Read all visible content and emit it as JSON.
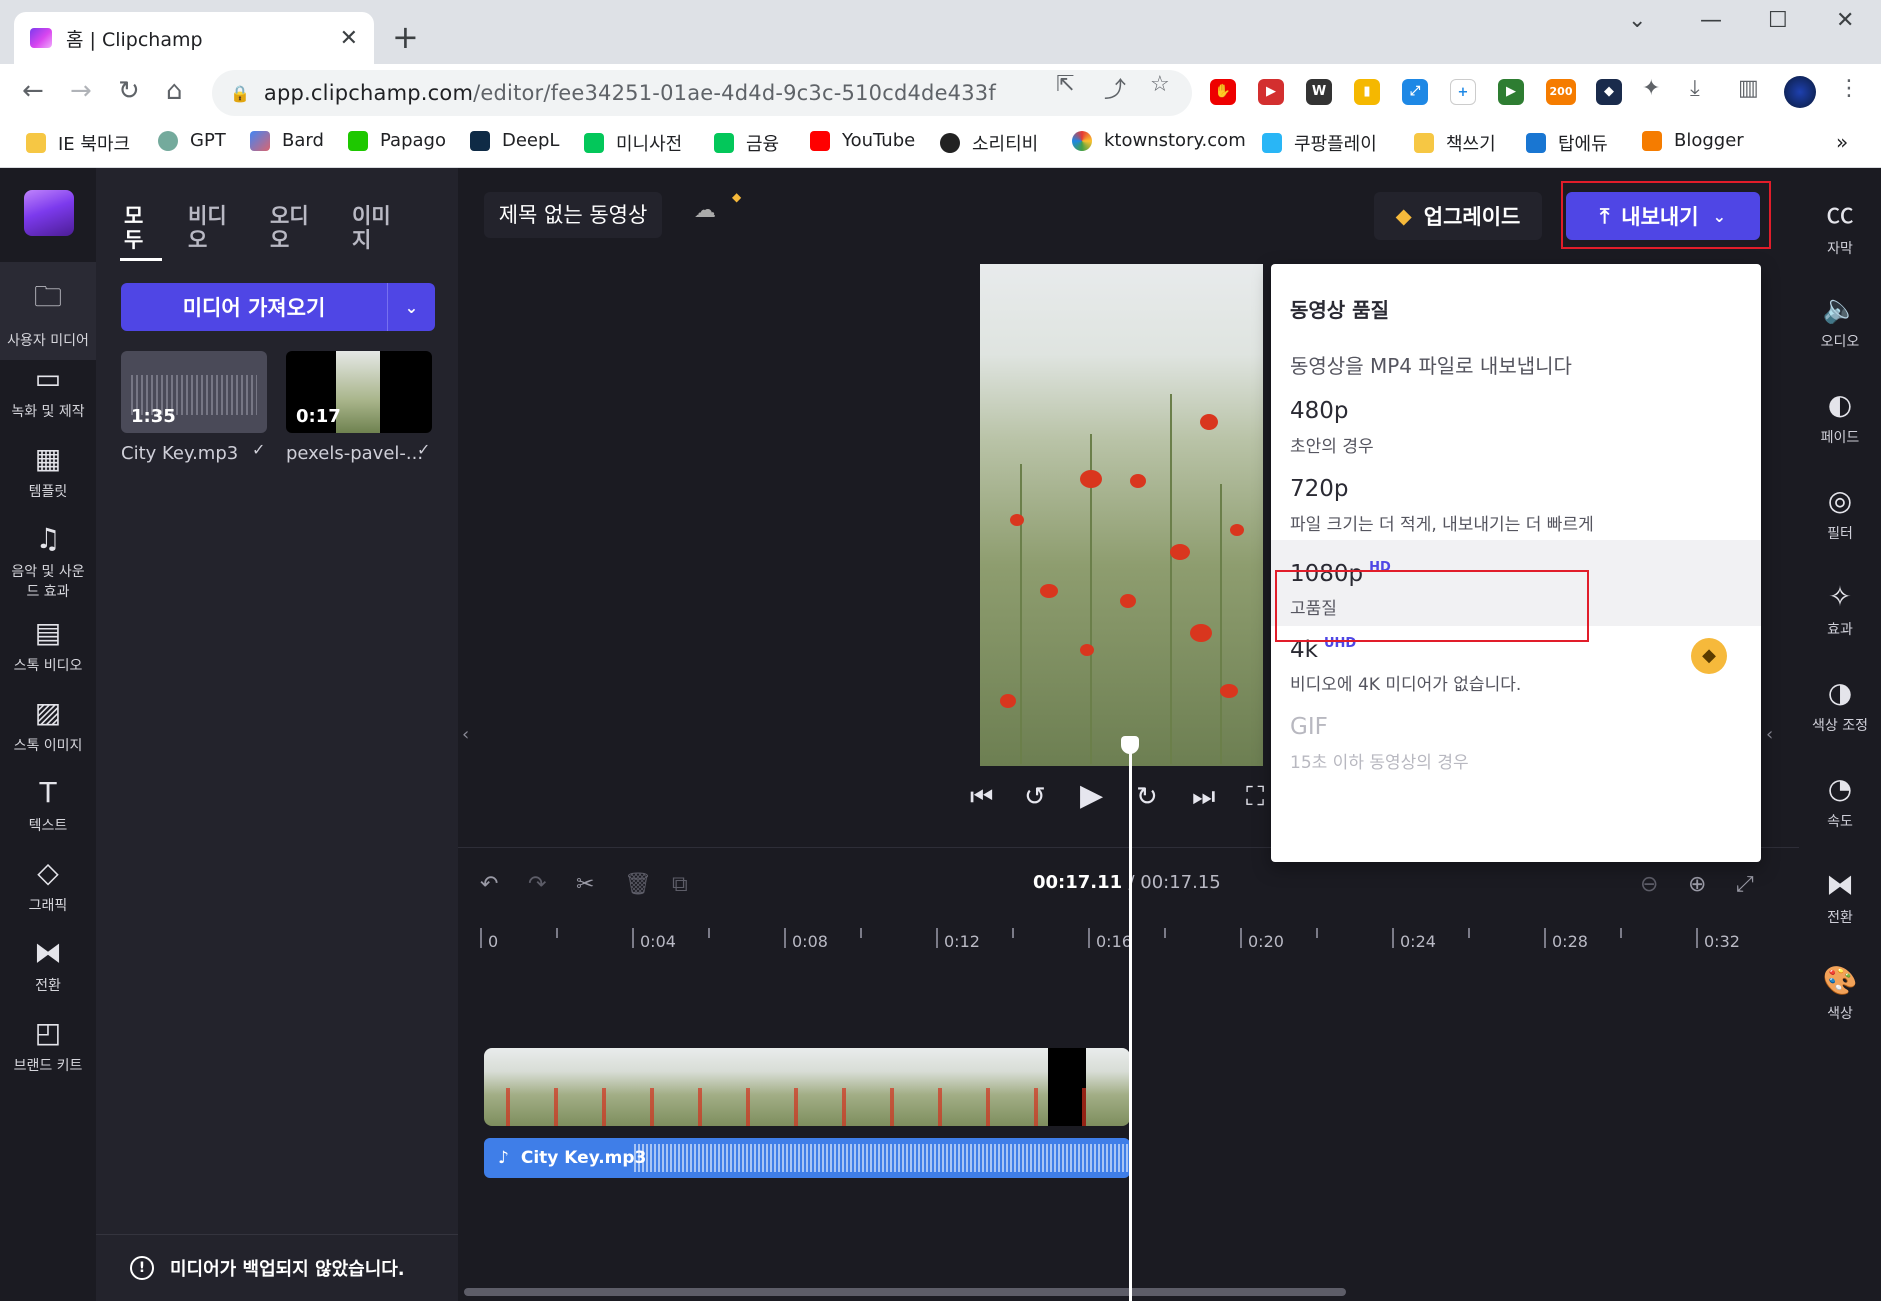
{
  "browser": {
    "tab_title": "홈 | Clipchamp",
    "url_host": "app.clipchamp.com",
    "url_path": "/editor/fee34251-01ae-4d4d-9c3c-510cd4de433f",
    "ext_badge": "200",
    "bookmarks": [
      "IE 북마크",
      "GPT",
      "Bard",
      "Papago",
      "DeepL",
      "미니사전",
      "금융",
      "YouTube",
      "소리티비",
      "ktownstory.com",
      "쿠팡플레이",
      "책쓰기",
      "탑에듀",
      "Blogger"
    ]
  },
  "left_nav": [
    {
      "label": "사용자 미디어",
      "icon": "folder-icon"
    },
    {
      "label": "녹화 및 제작",
      "icon": "video-camera-icon"
    },
    {
      "label": "템플릿",
      "icon": "template-icon"
    },
    {
      "label": "음악 및 사운드 효과",
      "icon": "music-icon"
    },
    {
      "label": "스톡 비디오",
      "icon": "film-icon"
    },
    {
      "label": "스톡 이미지",
      "icon": "image-icon"
    },
    {
      "label": "텍스트",
      "icon": "text-icon"
    },
    {
      "label": "그래픽",
      "icon": "shapes-icon"
    },
    {
      "label": "전환",
      "icon": "transition-icon"
    },
    {
      "label": "브랜드 키트",
      "icon": "brand-kit-icon"
    }
  ],
  "media_panel": {
    "tabs": [
      "모두",
      "비디오",
      "오디오",
      "이미지"
    ],
    "import_label": "미디어 가져오기",
    "items": [
      {
        "name": "City Key.mp3",
        "duration": "1:35"
      },
      {
        "name": "pexels-pavel-...",
        "duration": "0:17"
      }
    ],
    "backup_notice": "미디어가 백업되지 않았습니다."
  },
  "header": {
    "video_title": "제목 없는 동영상",
    "upgrade_label": "업그레이드",
    "export_label": "내보내기"
  },
  "export_menu": {
    "title": "동영상 품질",
    "subtitle": "동영상을 MP4 파일로 내보냅니다",
    "options": [
      {
        "label": "480p",
        "badge": "",
        "desc": "초안의 경우"
      },
      {
        "label": "720p",
        "badge": "",
        "desc": "파일 크기는 더 적게, 내보내기는 더 빠르게"
      },
      {
        "label": "1080p",
        "badge": "HD",
        "desc": "고품질"
      },
      {
        "label": "4k",
        "badge": "UHD",
        "desc": "비디오에 4K 미디어가 없습니다."
      },
      {
        "label": "GIF",
        "badge": "",
        "desc": "15초 이하 동영상의 경우"
      }
    ]
  },
  "right_nav": [
    {
      "label": "자막",
      "icon": "cc-icon"
    },
    {
      "label": "오디오",
      "icon": "speaker-icon"
    },
    {
      "label": "페이드",
      "icon": "fade-icon"
    },
    {
      "label": "필터",
      "icon": "filter-icon"
    },
    {
      "label": "효과",
      "icon": "magic-wand-icon"
    },
    {
      "label": "색상 조정",
      "icon": "contrast-icon"
    },
    {
      "label": "속도",
      "icon": "speedometer-icon"
    },
    {
      "label": "전환",
      "icon": "transition-icon"
    },
    {
      "label": "색상",
      "icon": "palette-icon"
    }
  ],
  "timeline": {
    "current_time": "00:17.11",
    "total_time": "/ 00:17.15",
    "ruler_labels": [
      "0",
      "0:04",
      "0:08",
      "0:12",
      "0:16",
      "0:20",
      "0:24",
      "0:28",
      "0:32"
    ],
    "audio_clip_label": "City Key.mp3"
  },
  "colors": {
    "accent": "#4f46e5",
    "highlight_border": "#e11d2a",
    "background": "#1b1b22"
  }
}
